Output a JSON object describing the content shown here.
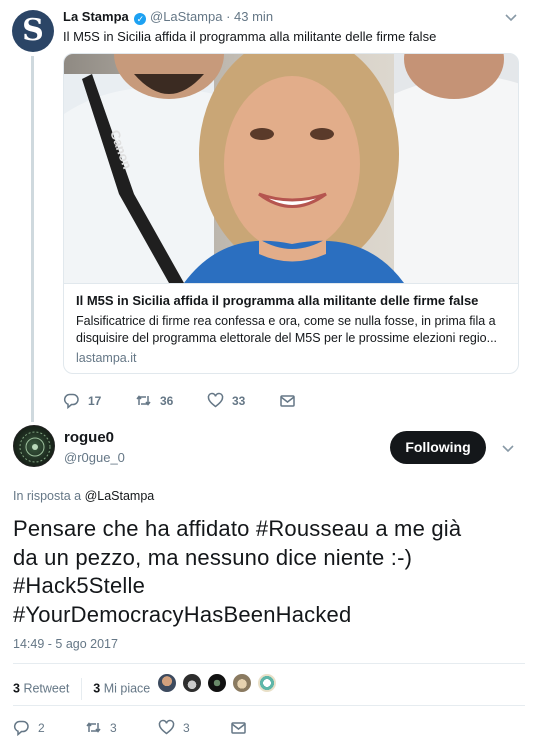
{
  "parent": {
    "avatar_letter": "S",
    "name": "La Stampa",
    "handle": "@LaStampa",
    "time": "· 43 min",
    "text": "Il M5S in Sicilia affida il programma alla militante delle firme false",
    "card": {
      "camera_text": "Canon",
      "title": "Il M5S in Sicilia affida il programma alla militante delle firme false",
      "description": "Falsificatrice di firme rea confessa e ora, come se nulla fosse, in prima fila a disquisire del programma elettorale del M5S per le prossime elezioni regio...",
      "domain": "lastampa.it"
    },
    "actions": {
      "replies": "17",
      "retweets": "36",
      "likes": "33"
    }
  },
  "tweet": {
    "name": "rogue0",
    "handle": "@r0gue_0",
    "follow_label": "Following",
    "reply_prefix": "In risposta a",
    "reply_to": "@LaStampa",
    "lines": [
      "Pensare che ha affidato #Rousseau a me già",
      "da un pezzo, ma nessuno dice niente :-)",
      "#Hack5Stelle",
      "#YourDemocracyHasBeenHacked"
    ],
    "timestamp": "14:49 - 5 ago 2017",
    "stats": {
      "retweets_count": "3",
      "retweets_label": "Retweet",
      "likes_count": "3",
      "likes_label": "Mi piace"
    },
    "actions": {
      "replies": "2",
      "retweets": "3",
      "likes": "3"
    }
  },
  "icons": [
    "reply-icon",
    "retweet-icon",
    "like-icon",
    "message-icon",
    "chevron-down-icon",
    "verified-icon"
  ],
  "colors": {
    "accent": "#1da1f2",
    "muted": "#657786",
    "text": "#14171a",
    "button": "#14171a"
  }
}
